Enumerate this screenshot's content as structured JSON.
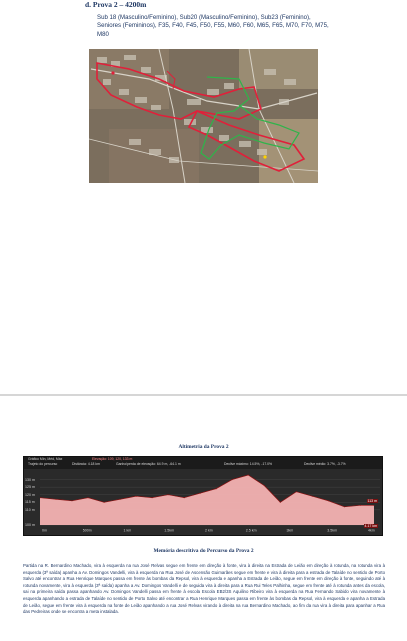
{
  "section": {
    "title": "d. Prova 2 – 4200m",
    "categories": "Sub 18 (Masculino/Feminino), Sub20 (Masculino/Feminino), Sub23 (Feminino), Seniores (Femininos), F35, F40, F45, F50, F55, M60, F60, M65, F65, M70, F70, M75, M80"
  },
  "altimetry": {
    "title": "Altimetria da Prova 2",
    "header": {
      "row1_a": "Gráfico   Mín, Méd, Máx",
      "row1_b": "Elevação: 109, 120, 133 m",
      "row2_a": "Trajeto do percurso",
      "row2_b": "Distância: 4.18 km",
      "row2_c": "Ganho/perda de elevação: 64.9 m, -64.1 m",
      "row2_d": "Declive máximo: 14.5%, -17.0%",
      "row2_e": "Declive médio: 3.7%, -3.7%"
    },
    "y_ticks": [
      "130 m",
      "125 m",
      "120 m",
      "115 m",
      "110 m",
      "100 m"
    ],
    "x_ticks": [
      "0m",
      "500m",
      "1 km",
      "1.5km",
      "2 km",
      "2.5 km",
      "3km",
      "3.5km",
      "4km"
    ],
    "end_label": "113 m",
    "end_label2": "4.17 km"
  },
  "chart_data": {
    "type": "area",
    "x": [
      0,
      0.2,
      0.4,
      0.6,
      0.8,
      1.0,
      1.2,
      1.4,
      1.6,
      1.8,
      2.0,
      2.2,
      2.4,
      2.6,
      2.8,
      3.0,
      3.2,
      3.4,
      3.6,
      3.8,
      4.0,
      4.17
    ],
    "series": [
      {
        "values": [
          118,
          117,
          116,
          118,
          115,
          117,
          119,
          118,
          120,
          118,
          121,
          124,
          130,
          133,
          126,
          115,
          122,
          119,
          116,
          112,
          113,
          113
        ]
      }
    ],
    "ylim": [
      100,
      135
    ],
    "xlim": [
      0,
      4.17
    ]
  },
  "memo": {
    "title": "Memória descritiva do Percurso da Prova 2",
    "text": "Partida na R. Bernardino Machado, vira à esquerda na rua José Relvas segue em frente em direção à fonte, vira à direita na Estrada de Leião em direção à rotunda, na rotunda vira à esquerda (3ª saída) apanha a Av. Domingos Vandelli, vira à esquerda na Rua José de Ascensão Guimarães segue em frente e vira à direita para a estrada de Talaíde no sentido de Porto Salvo até encontrar a Rua Henrique Marques passa em frente às bombas da Repsol, vira à esquerda e apanha a Estrada de Leião, segue em frente em direção à fonte, seguindo até à rotunda novamente, vira à esquerda (3ª saída) apanha a Av. Domingos Vandelli e de seguida vira à direita para a Rua Rui Teles Palhinha, segue em frente até à rotunda antes da escola, sai na primeira saída passa apanhando Av. Domingos Vandelli passa em frente à escola Escola EB2/3S Aquilino Ribeiro vira à esquerda na Rua Fernando Sabido vira novamente à esquerda apanhando a estrada de Talaíde no sentido de Porto Salvo até encontrar a Rua Henrique Marques passa em frente às bombas da Repsol, vira à esquerda e apanha a Estrada de Leião, segue em frente vira à esquerda na fonte de Leião apanhando a rua José Relvas virando à direita na rua Bernardino Machado, ao fim da rua vira à direita para apanhar a Rua das Pedreiras onde se encontra a meta instalada."
  },
  "colors": {
    "route_red": "#e0203a",
    "route_green": "#2fb44a",
    "profile_fill": "#f4b2b2",
    "profile_line": "#ffffff"
  }
}
